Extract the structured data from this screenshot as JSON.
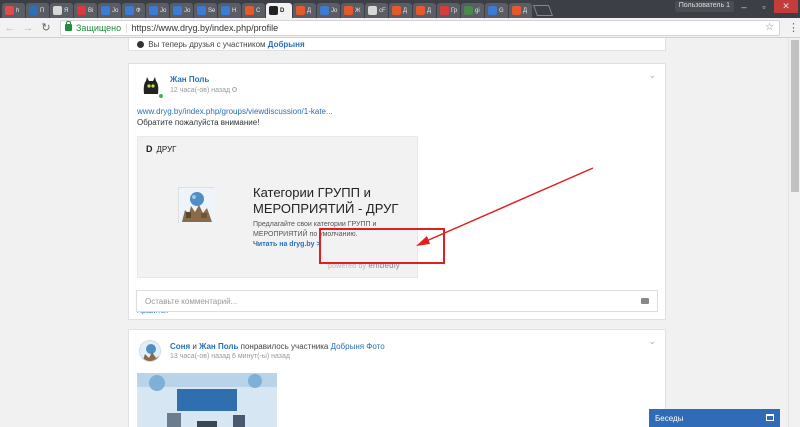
{
  "browser": {
    "tabs": [
      {
        "label": "h",
        "color": "#e24b4b"
      },
      {
        "label": "П",
        "color": "#2b6fb6"
      },
      {
        "label": "Я",
        "color": "#d8d8d8"
      },
      {
        "label": "Bi",
        "color": "#d93a3a"
      },
      {
        "label": "Jo",
        "color": "#3a7bd5"
      },
      {
        "label": "Ф",
        "color": "#3a7bd5"
      },
      {
        "label": "Jo",
        "color": "#3a7bd5"
      },
      {
        "label": "Jo",
        "color": "#3a7bd5"
      },
      {
        "label": "Se",
        "color": "#3a7bd5"
      },
      {
        "label": "Н",
        "color": "#3a7bd5"
      },
      {
        "label": "С",
        "color": "#e55a2b"
      },
      {
        "label": "D",
        "color": "#222222",
        "active": true
      },
      {
        "label": "Д",
        "color": "#e55a2b"
      },
      {
        "label": "Jo",
        "color": "#3a7bd5"
      },
      {
        "label": "Ж",
        "color": "#e55a2b"
      },
      {
        "label": "cF",
        "color": "#d8d8d8"
      },
      {
        "label": "Д",
        "color": "#e55a2b"
      },
      {
        "label": "Д",
        "color": "#e55a2b"
      },
      {
        "label": "Гр",
        "color": "#d93a3a"
      },
      {
        "label": "gi",
        "color": "#4a8a4a"
      },
      {
        "label": "G",
        "color": "#3a7bd5"
      },
      {
        "label": "Д",
        "color": "#e55a2b"
      }
    ],
    "user_button": "Пользователь 1",
    "secure_label": "Защищено",
    "url": "https://www.dryg.by/index.php/profile"
  },
  "feed": {
    "prev_item_text_pre": "Вы теперь друзья с участником",
    "prev_item_friend": "Добрыня",
    "post": {
      "author": "Жан Поль",
      "timestamp": "12 часа(-ов) назад",
      "link": "www.dryg.by/index.php/groups/viewdiscussion/1-kate...",
      "text": "Обратите пожалуйста внимание!",
      "embed": {
        "source": "ДРУГ",
        "title": "Категории ГРУПП и МЕРОПРИЯТИЙ - ДРУГ",
        "description": "Предлагайте свои категории ГРУПП и МЕРОПРИЯТИЙ по умолчанию.",
        "read_more": "Читать на dryg.by >",
        "powered_by": "powered by",
        "powered_brand": "embedly"
      },
      "like": "Нравится",
      "comment_placeholder": "Оставьте комментарий..."
    },
    "activity": {
      "user1": "Соня",
      "conj": "и",
      "user2": "Жан Поль",
      "text": "понравилось участника",
      "link": "Добрыня Фото",
      "timestamp": "13 часа(-ов) назад 6 минут(-ы) назад"
    }
  },
  "chat": {
    "label": "Беседы"
  },
  "annotation_color": "#e02020"
}
